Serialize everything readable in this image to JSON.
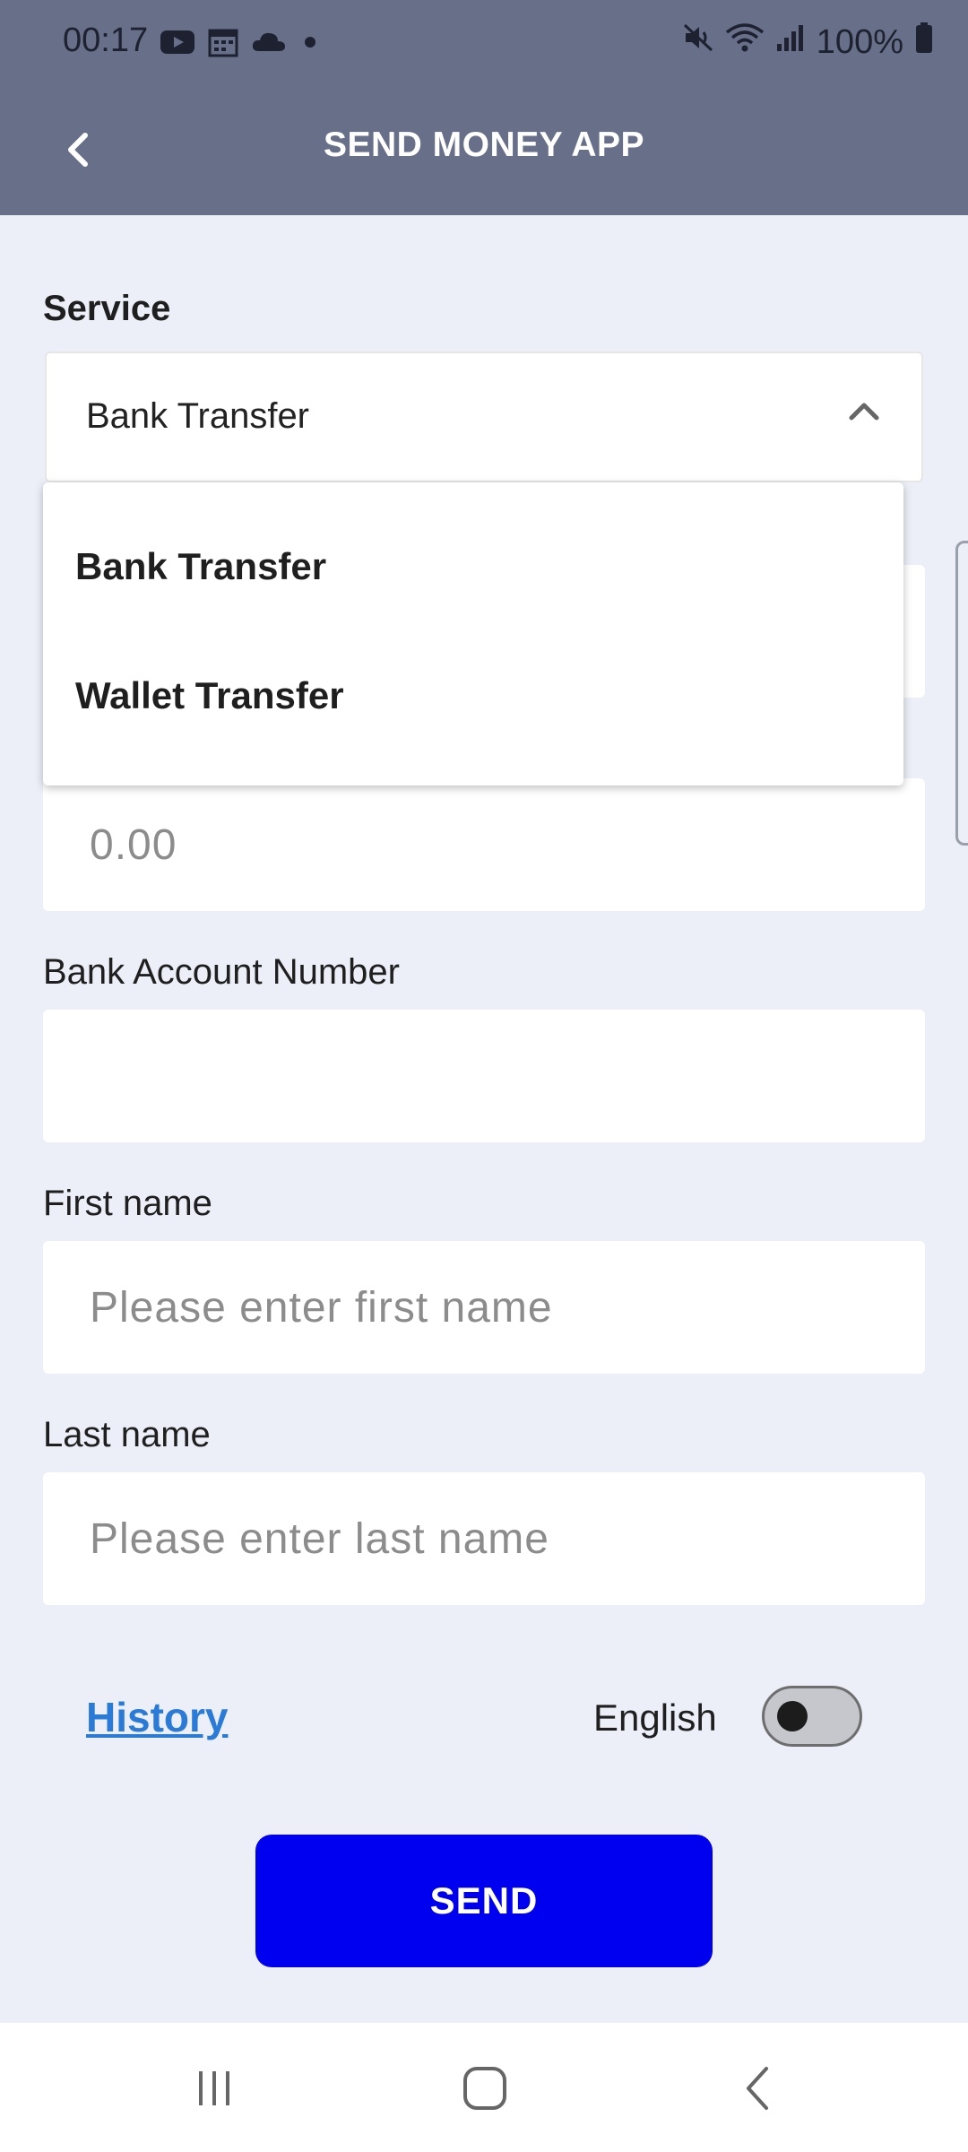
{
  "status_bar": {
    "time": "00:17",
    "battery": "100%",
    "left_icons": [
      "youtube-icon",
      "calendar-icon",
      "cloud-icon",
      "dot-icon"
    ],
    "right_icons": [
      "mute-icon",
      "wifi-icon",
      "signal-icon",
      "battery-icon"
    ]
  },
  "app_bar": {
    "title": "SEND MONEY APP"
  },
  "form": {
    "service_label": "Service",
    "service_selected": "Bank Transfer",
    "service_options": [
      "Bank Transfer",
      "Wallet Transfer"
    ],
    "amount_placeholder": "0.00",
    "account_label": "Bank Account Number",
    "account_value": "",
    "first_name_label": "First name",
    "first_name_placeholder": "Please enter first name",
    "last_name_label": "Last name",
    "last_name_placeholder": "Please enter last name"
  },
  "footer": {
    "history_link": "History",
    "language_label": "English",
    "language_toggle_on": false,
    "send_button": "SEND"
  },
  "colors": {
    "app_bar": "#687089",
    "background": "#eceff8",
    "send_button": "#0000f0",
    "link": "#2a7bd8"
  }
}
